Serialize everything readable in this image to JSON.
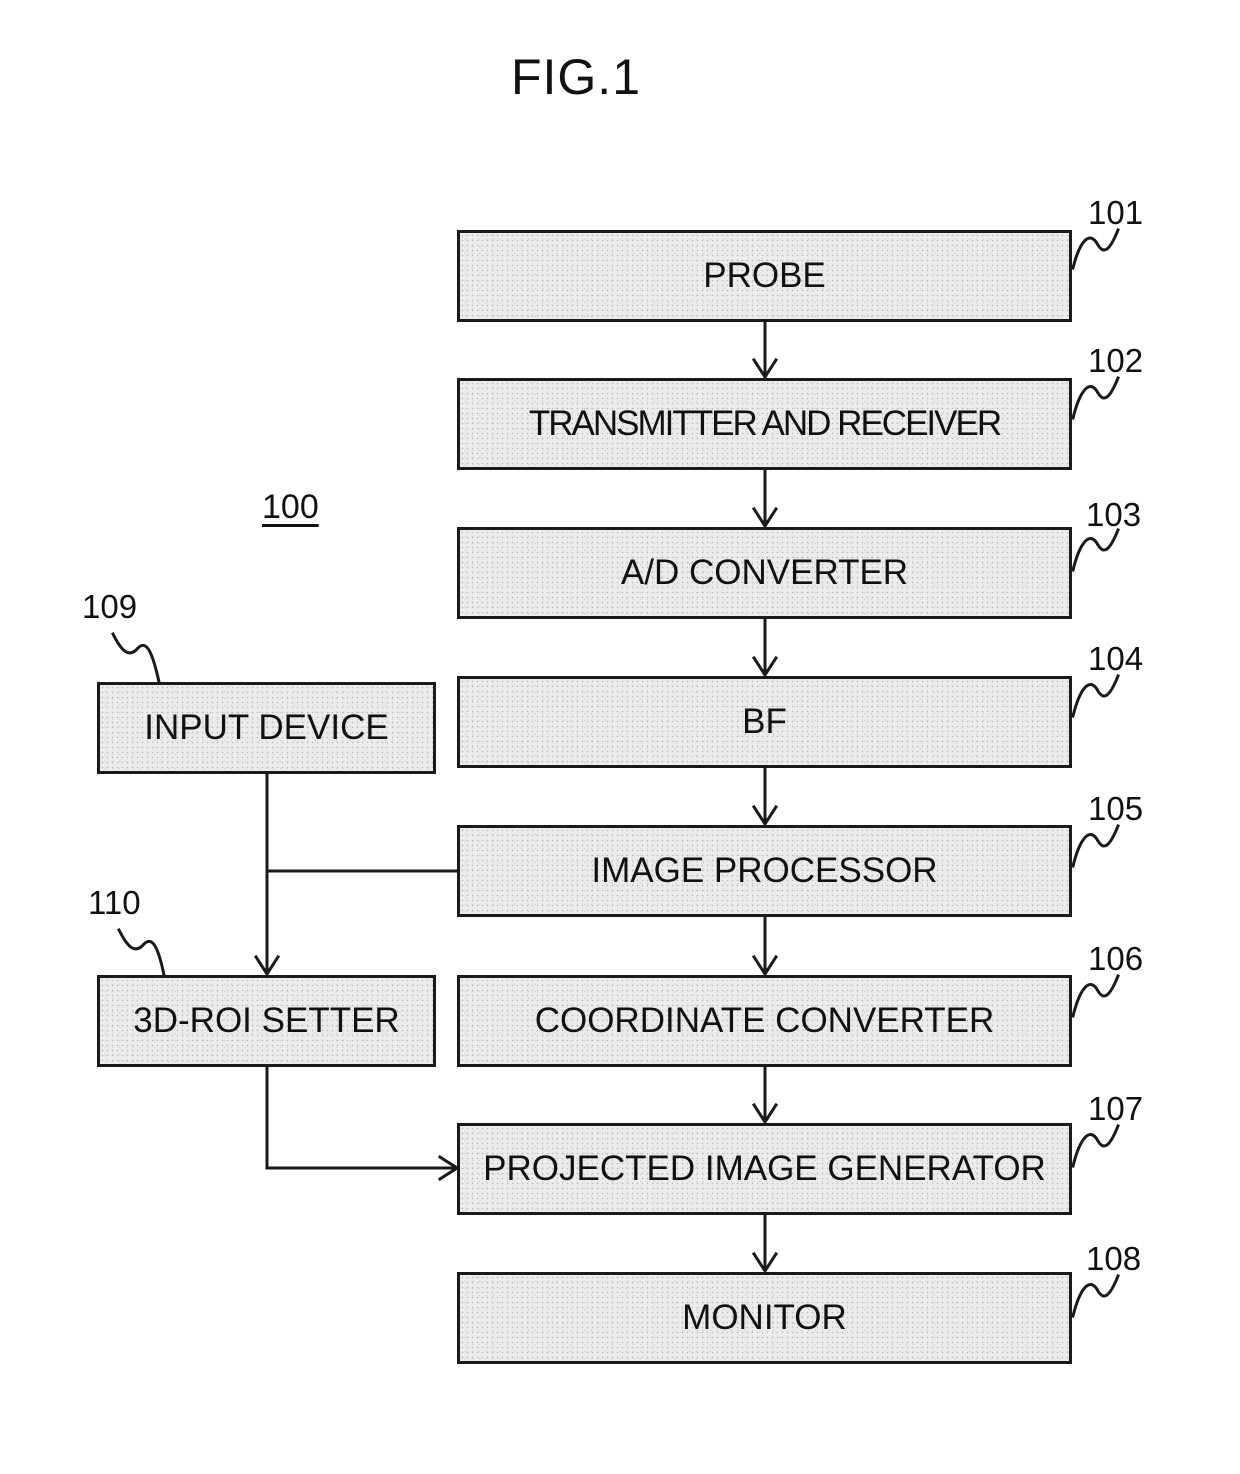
{
  "figure": {
    "title": "FIG.1",
    "system_ref": "100"
  },
  "blocks": [
    {
      "id": "probe",
      "ref": "101",
      "label": "PROBE"
    },
    {
      "id": "transmitter-and-receiver",
      "ref": "102",
      "label": "TRANSMITTER AND RECEIVER"
    },
    {
      "id": "ad-converter",
      "ref": "103",
      "label": "A/D CONVERTER"
    },
    {
      "id": "bf",
      "ref": "104",
      "label": "BF"
    },
    {
      "id": "image-processor",
      "ref": "105",
      "label": "IMAGE PROCESSOR"
    },
    {
      "id": "coordinate-converter",
      "ref": "106",
      "label": "COORDINATE CONVERTER"
    },
    {
      "id": "projected-image-generator",
      "ref": "107",
      "label": "PROJECTED IMAGE GENERATOR"
    },
    {
      "id": "monitor",
      "ref": "108",
      "label": "MONITOR"
    },
    {
      "id": "input-device",
      "ref": "109",
      "label": "INPUT DEVICE"
    },
    {
      "id": "3d-roi-setter",
      "ref": "110",
      "label": "3D-ROI SETTER"
    }
  ],
  "connections": [
    {
      "from": "probe",
      "to": "transmitter-and-receiver"
    },
    {
      "from": "transmitter-and-receiver",
      "to": "ad-converter"
    },
    {
      "from": "ad-converter",
      "to": "bf"
    },
    {
      "from": "bf",
      "to": "image-processor"
    },
    {
      "from": "image-processor",
      "to": "coordinate-converter"
    },
    {
      "from": "coordinate-converter",
      "to": "projected-image-generator"
    },
    {
      "from": "projected-image-generator",
      "to": "monitor"
    },
    {
      "from": "input-device",
      "to": "3d-roi-setter"
    },
    {
      "from": "image-processor",
      "to": "3d-roi-setter"
    },
    {
      "from": "3d-roi-setter",
      "to": "projected-image-generator"
    }
  ]
}
